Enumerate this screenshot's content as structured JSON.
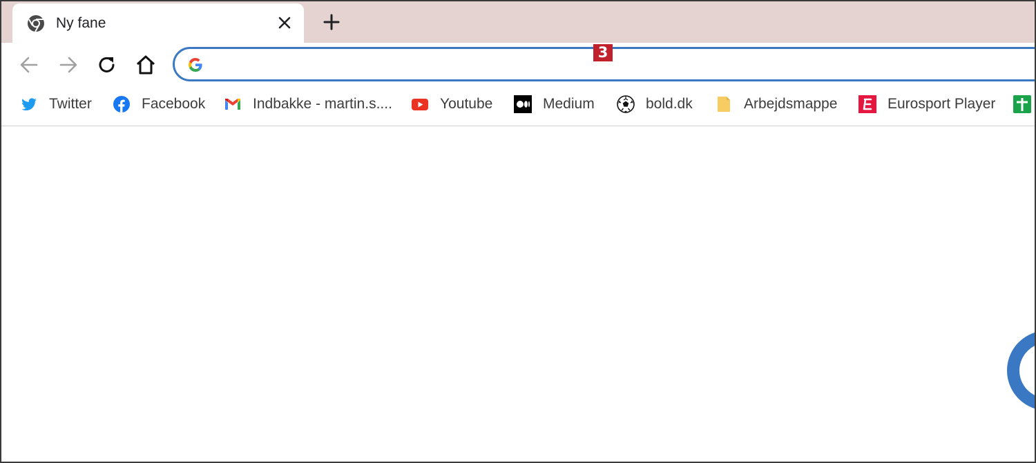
{
  "tab": {
    "title": "Ny fane",
    "favicon": "chrome-icon"
  },
  "toolbar": {
    "back": "arrow-left-icon",
    "forward": "arrow-right-icon",
    "reload": "reload-icon",
    "home": "home-icon",
    "omnibox_value": "",
    "step_badge": "3"
  },
  "bookmarks": [
    {
      "label": "Twitter",
      "icon": "twitter-icon"
    },
    {
      "label": "Facebook",
      "icon": "facebook-icon"
    },
    {
      "label": "Indbakke - martin.s....",
      "icon": "gmail-icon"
    },
    {
      "label": "Youtube",
      "icon": "youtube-icon"
    },
    {
      "label": "Medium",
      "icon": "medium-icon"
    },
    {
      "label": "bold.dk",
      "icon": "soccer-ball-icon"
    },
    {
      "label": "Arbejdsmappe",
      "icon": "folder-icon"
    },
    {
      "label": "Eurosport Player",
      "icon": "eurosport-icon"
    }
  ],
  "colors": {
    "tabstrip": "#e5d3d1",
    "omnibox_border": "#3b78c4",
    "badge": "#c0202b",
    "spinner": "#3a78c3"
  }
}
